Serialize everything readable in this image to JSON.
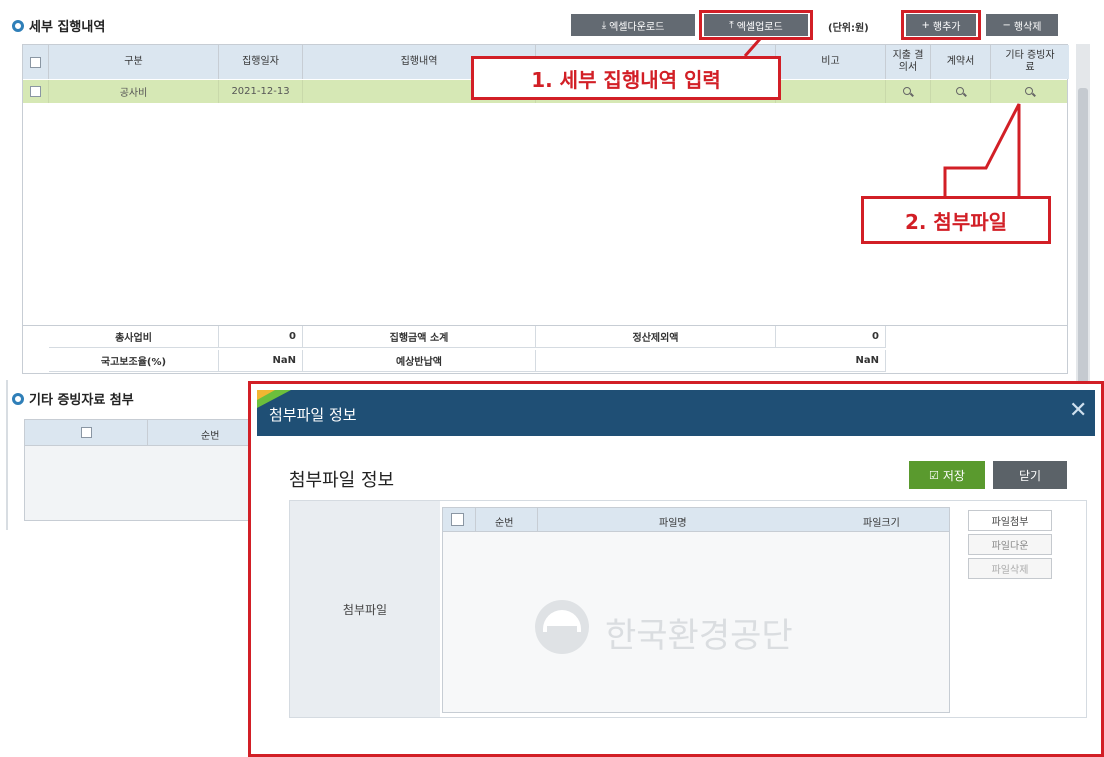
{
  "main": {
    "section_title": "세부 집행내역",
    "btn_excel_download": "엑셀다운로드",
    "btn_excel_upload": "엑셀업로드",
    "unit_label": "(단위:원)",
    "btn_add_row": "행추가",
    "btn_delete_row": "행삭제",
    "columns": [
      "구분",
      "집행일자",
      "집행내역",
      "비고",
      "지출 결의서",
      "계약서",
      "기타 증빙자료"
    ],
    "row": {
      "category": "공사비",
      "date": "2021-12-13"
    },
    "footer": {
      "total_label": "총사업비",
      "total_value": "0",
      "subtotal_label": "집행금액 소계",
      "exclusion_label": "정산제외액",
      "exclusion_value": "0",
      "subsidy_label": "국고보조율(%)",
      "subsidy_value": "NaN",
      "refund_label": "예상반납액",
      "refund_value": "NaN"
    }
  },
  "other_section": {
    "title": "기타 증빙자료 첨부",
    "col_seq": "순번"
  },
  "annotations": {
    "step1": "1. 세부 집행내역 입력",
    "step2": "2. 첨부파일"
  },
  "dialog": {
    "title": "첨부파일 정보",
    "heading": "첨부파일 정보",
    "save_label": "저장",
    "close_label": "닫기",
    "row_label": "첨부파일",
    "columns": {
      "seq": "순번",
      "filename": "파일명",
      "filesize": "파일크기"
    },
    "btn_attach": "파일첨부",
    "btn_download": "파일다운",
    "btn_delete": "파일삭제",
    "watermark": "한국환경공단"
  },
  "colors": {
    "accent_red": "#d21f26",
    "header_blue": "#1f4f75",
    "save_green": "#5a9a2e",
    "row_green": "#d6e8b5"
  }
}
